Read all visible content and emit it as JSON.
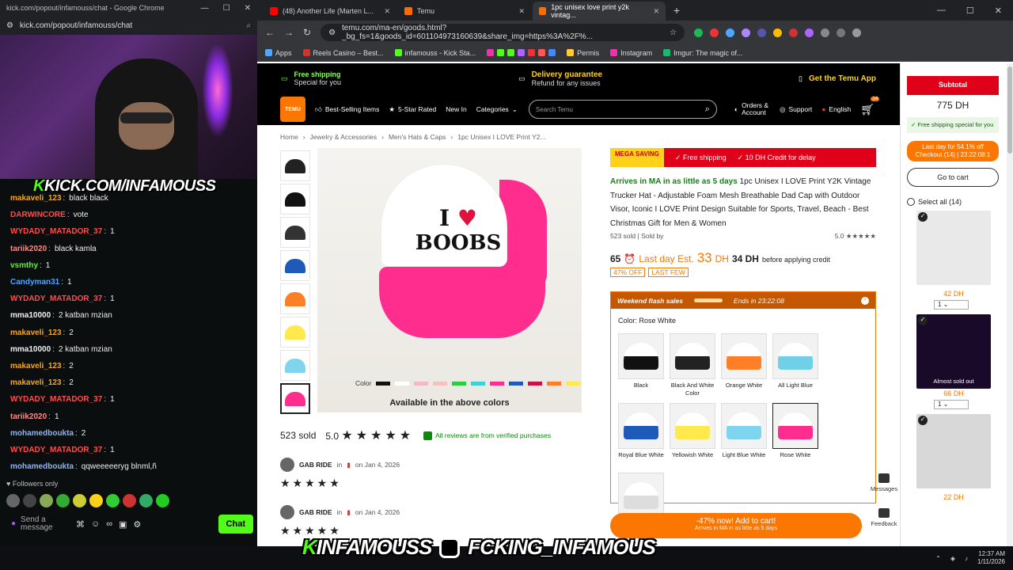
{
  "chat_window": {
    "title": "kick.com/popout/infamouss/chat - Google Chrome",
    "url": "kick.com/popout/infamouss/chat",
    "overlay_tag": "KICK.COM/INFAMOUSS",
    "messages": [
      {
        "user": "makaveli_123",
        "color": "#f5a623",
        "text": "black black"
      },
      {
        "user": "DARWINCORE",
        "color": "#ff4d4d",
        "text": "vote"
      },
      {
        "user": "WYDADY_MATADOR_37",
        "color": "#ff4d4d",
        "text": "1"
      },
      {
        "user": "tariik2020",
        "color": "#ff8a8a",
        "text": "black kamla"
      },
      {
        "user": "vsmthy",
        "color": "#53fc18",
        "text": "1"
      },
      {
        "user": "Candyman31",
        "color": "#4da6ff",
        "text": "1"
      },
      {
        "user": "WYDADY_MATADOR_37",
        "color": "#ff4d4d",
        "text": "1"
      },
      {
        "user": "mma10000",
        "color": "#f0f0f0",
        "text": "2 katban mzian"
      },
      {
        "user": "makaveli_123",
        "color": "#f5a623",
        "text": "2"
      },
      {
        "user": "mma10000",
        "color": "#f0f0f0",
        "text": "2 katban mzian"
      },
      {
        "user": "makaveli_123",
        "color": "#f5a623",
        "text": "2"
      },
      {
        "user": "makaveli_123",
        "color": "#f5a623",
        "text": "2"
      },
      {
        "user": "WYDADY_MATADOR_37",
        "color": "#ff4d4d",
        "text": "1"
      },
      {
        "user": "tariik2020",
        "color": "#ff8a8a",
        "text": "1"
      },
      {
        "user": "mohamedboukta",
        "color": "#8ab4ff",
        "text": "2"
      },
      {
        "user": "WYDADY_MATADOR_37",
        "color": "#ff4d4d",
        "text": "1"
      },
      {
        "user": "mohamedboukta",
        "color": "#8ab4ff",
        "text": "qqweeeeeryg blnml,ñ"
      }
    ],
    "followers_only": "Followers only",
    "send_placeholder": "Send a message",
    "chat_button": "Chat"
  },
  "browser": {
    "tabs": [
      {
        "label": "(48) Another Life (Marten L...",
        "icon": "youtube-icon"
      },
      {
        "label": "Temu",
        "icon": "temu-icon"
      },
      {
        "label": "1pc unisex love print y2k vintag...",
        "icon": "temu-icon"
      }
    ],
    "url": "temu.com/ma-en/goods.html?_bg_fs=1&goods_id=601104973160639&share_img=https%3A%2F%...",
    "bookmarks": [
      "Apps",
      "Reels Casino – Best...",
      "infamouss - Kick Sta...",
      "Permis",
      "Instagram",
      "Imgur: The magic of..."
    ]
  },
  "temu": {
    "topbar": {
      "free_shipping": "Free shipping",
      "free_shipping_sub": "Special for you",
      "delivery": "Delivery guarantee",
      "delivery_sub": "Refund for any issues",
      "app": "Get the Temu App"
    },
    "logo": "TEMU",
    "nav": [
      "Best-Selling Items",
      "5-Star Rated",
      "New In",
      "Categories"
    ],
    "search_placeholder": "Search Temu",
    "orders": "Orders & Account",
    "support": "Support",
    "language": "English",
    "cart_count": "14",
    "breadcrumbs": [
      "Home",
      "Jewelry & Accessories",
      "Men's Hats & Caps",
      "1pc Unisex I LOVE Print Y2..."
    ],
    "image_text": {
      "line1": "I ♥",
      "line2": "BOOBS",
      "color_label": "Color",
      "available": "Available in the above colors"
    },
    "swatch_colors": [
      "#111111",
      "#ffffff",
      "#f4b8c8",
      "#f4c2c2",
      "#2ecc40",
      "#3dd1d1",
      "#ff2e8e",
      "#1e5bb8",
      "#cc1144",
      "#ff7f27",
      "#ffe94d"
    ],
    "sold": "523 sold",
    "rating": "5.0",
    "verified": "All reviews are from verified purchases",
    "reviews": [
      {
        "name": "GAB RIDE",
        "date": "on Jan 4, 2026"
      },
      {
        "name": "GAB RIDE",
        "date": "on Jan 4, 2026"
      }
    ],
    "promo": {
      "mega": "MEGA SAVING",
      "free_ship": "✓ Free shipping",
      "credit": "✓ 10 DH Credit for delay"
    },
    "title_arrival": "Arrives in MA in as little as 5 days",
    "title": "1pc Unisex I LOVE Print Y2K Vintage Trucker Hat - Adjustable Foam Mesh Breathable Dad Cap with Outdoor Visor, Iconic I LOVE Print Design Suitable for Sports, Travel, Beach - Best Christmas Gift for Men & Women",
    "sold_by": "523 sold | Sold by",
    "score": "5.0 ★★★★★",
    "price": {
      "current": "65",
      "lastday": "Last day Est.",
      "est": "33",
      "unit": "DH",
      "after": "34 DH",
      "after_note": "before applying credit",
      "discount": "47% OFF",
      "lastfew": "LAST FEW"
    },
    "flash": {
      "title": "Weekend flash sales",
      "ends": "Ends in 23:22:08"
    },
    "color_selected": "Color: Rose White",
    "options": [
      {
        "label": "Black",
        "color": "#111111"
      },
      {
        "label": "Black And White Color",
        "color": "#222222"
      },
      {
        "label": "Orange White",
        "color": "#ff7f27"
      },
      {
        "label": "All Light Blue",
        "color": "#6fd0e8"
      },
      {
        "label": "Royal Blue White",
        "color": "#1e5bb8"
      },
      {
        "label": "Yellowish White",
        "color": "#ffe94d"
      },
      {
        "label": "Light Blue White",
        "color": "#7fd4ee"
      },
      {
        "label": "Rose White",
        "color": "#ff2e8e"
      },
      {
        "label": "",
        "color": "#dddddd"
      }
    ],
    "cart_button": "-47% now! Add to cart!",
    "cart_sub": "Arrives in MA in as little as 5 days",
    "messages": "Messages",
    "feedback": "Feedback",
    "cart_panel": {
      "subtotal": "Subtotal",
      "amount": "775 DH",
      "free_shipping": "Free shipping special for you",
      "last_day": "Last day for 54.1% off",
      "checkout": "Checkout (14) | 23:22:08:1",
      "go_to_cart": "Go to cart",
      "select_all": "Select all (14)",
      "items": [
        {
          "price": "42 DH",
          "qty": "1",
          "note": "",
          "bg": "#e9e9e9"
        },
        {
          "price": "66 DH",
          "qty": "1",
          "note": "Almost sold out",
          "bg": "#1a0a2a"
        },
        {
          "price": "22 DH",
          "qty": "",
          "note": "",
          "bg": "#d8d8d8"
        }
      ]
    }
  },
  "stream_overlay": {
    "kick": "INFAMOUSS",
    "instagram": "FCKING_INFAMOUS"
  },
  "taskbar": {
    "time": "12:37 AM",
    "date": "1/11/2026"
  }
}
